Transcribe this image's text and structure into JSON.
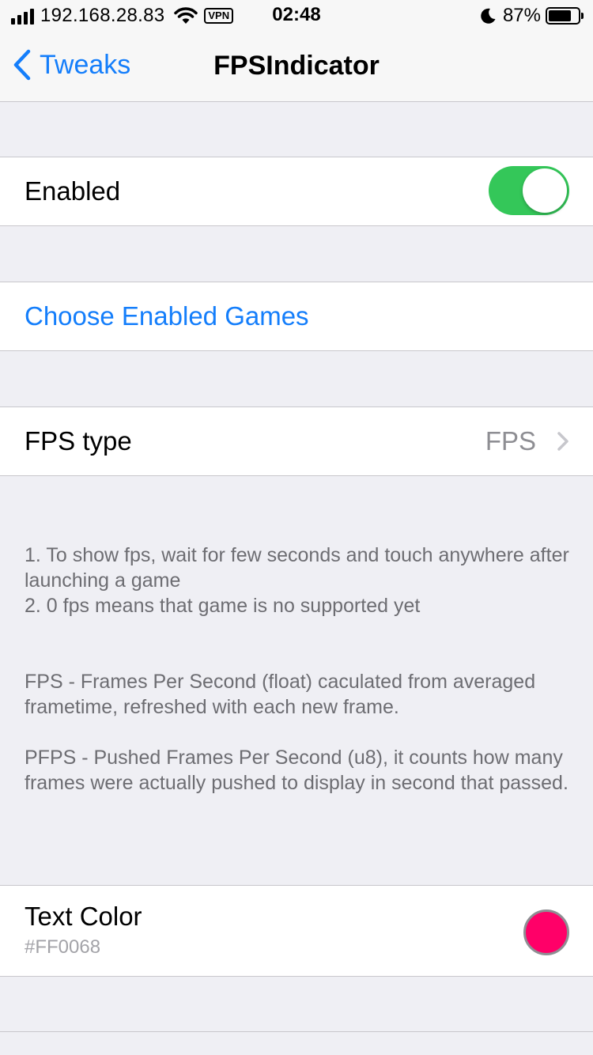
{
  "status_bar": {
    "ip": "192.168.28.83",
    "vpn": "VPN",
    "time": "02:48",
    "battery_percent": "87%",
    "battery_level": 0.87,
    "icons": [
      "signal-icon",
      "wifi-icon",
      "moon-icon",
      "battery-icon"
    ]
  },
  "nav": {
    "back_label": "Tweaks",
    "title": "FPSIndicator",
    "back_icon": "chevron-left-icon"
  },
  "settings": {
    "enabled": {
      "label": "Enabled",
      "value": true
    },
    "choose_games": {
      "label": "Choose Enabled Games"
    },
    "fps_type": {
      "label": "FPS type",
      "value": "FPS"
    },
    "footer_notes": "1. To show fps, wait for few seconds and touch anywhere after launching a game\n2. 0 fps means that game is no supported yet",
    "fps_description": "FPS - Frames Per Second (float) caculated from averaged frametime, refreshed with each new frame.",
    "pfps_description": "PFPS - Pushed Frames Per Second (u8), it counts how many frames were actually pushed to display in second that passed.",
    "text_color": {
      "label": "Text Color",
      "value": "#FF0068"
    }
  },
  "colors": {
    "accent": "#147efb",
    "switch_on": "#34c759",
    "swatch": "#FF0068",
    "background": "#efeff4"
  }
}
